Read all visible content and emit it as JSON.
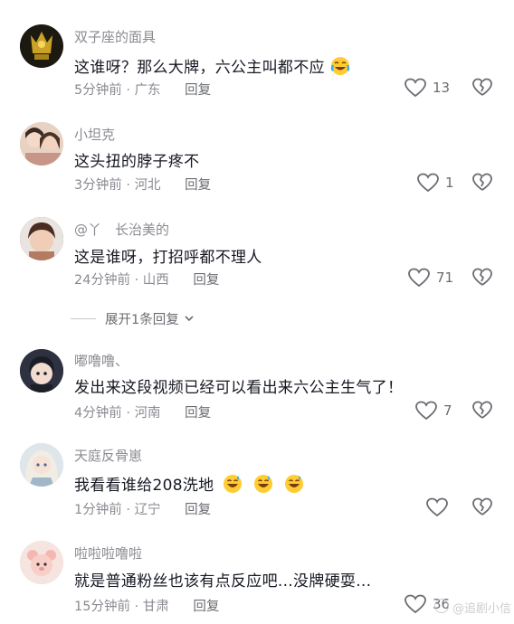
{
  "comments": [
    {
      "username": "双子座的面具",
      "text": "这谁呀？那么大牌，六公主叫都不应",
      "time": "5分钟前",
      "location": "广东",
      "reply": "回复",
      "likes": "13",
      "emoji": "laugh-cry",
      "avatar_color": "#1c1a10"
    },
    {
      "username": "小坦克",
      "text": "这头扭的脖子疼不",
      "time": "3分钟前",
      "location": "河北",
      "reply": "回复",
      "likes": "1",
      "avatar_color": "#d9b59c"
    },
    {
      "username": "@丫　长治美的",
      "text": "这是谁呀，打招呼都不理人",
      "time": "24分钟前",
      "location": "山西",
      "reply": "回复",
      "likes": "71",
      "avatar_color": "#6b4a3a"
    },
    {
      "username": "嘟噜噜、",
      "text": "发出来这段视频已经可以看出来六公主生气了！",
      "time": "4分钟前",
      "location": "河南",
      "reply": "回复",
      "likes": "7",
      "avatar_color": "#3d3e4a"
    },
    {
      "username": "天庭反骨崽",
      "text": "我看看谁给208洗地",
      "time": "1分钟前",
      "location": "辽宁",
      "reply": "回复",
      "likes": "",
      "emoji": "sweat-smile",
      "avatar_color": "#cfd8dd"
    },
    {
      "username": "啦啦啦噜啦",
      "text": "就是普通粉丝也该有点反应吧...没牌硬耍...",
      "time": "15分钟前",
      "location": "甘肃",
      "reply": "回复",
      "likes": "36",
      "avatar_color": "#f2c9c4"
    }
  ],
  "expand_replies": {
    "label": "展开1条回复"
  },
  "separator": "·",
  "colors": {
    "text": "#161823",
    "meta": "#8a8b91",
    "icon": "#6b6c72"
  },
  "watermark": {
    "text": "@追剧小信"
  }
}
